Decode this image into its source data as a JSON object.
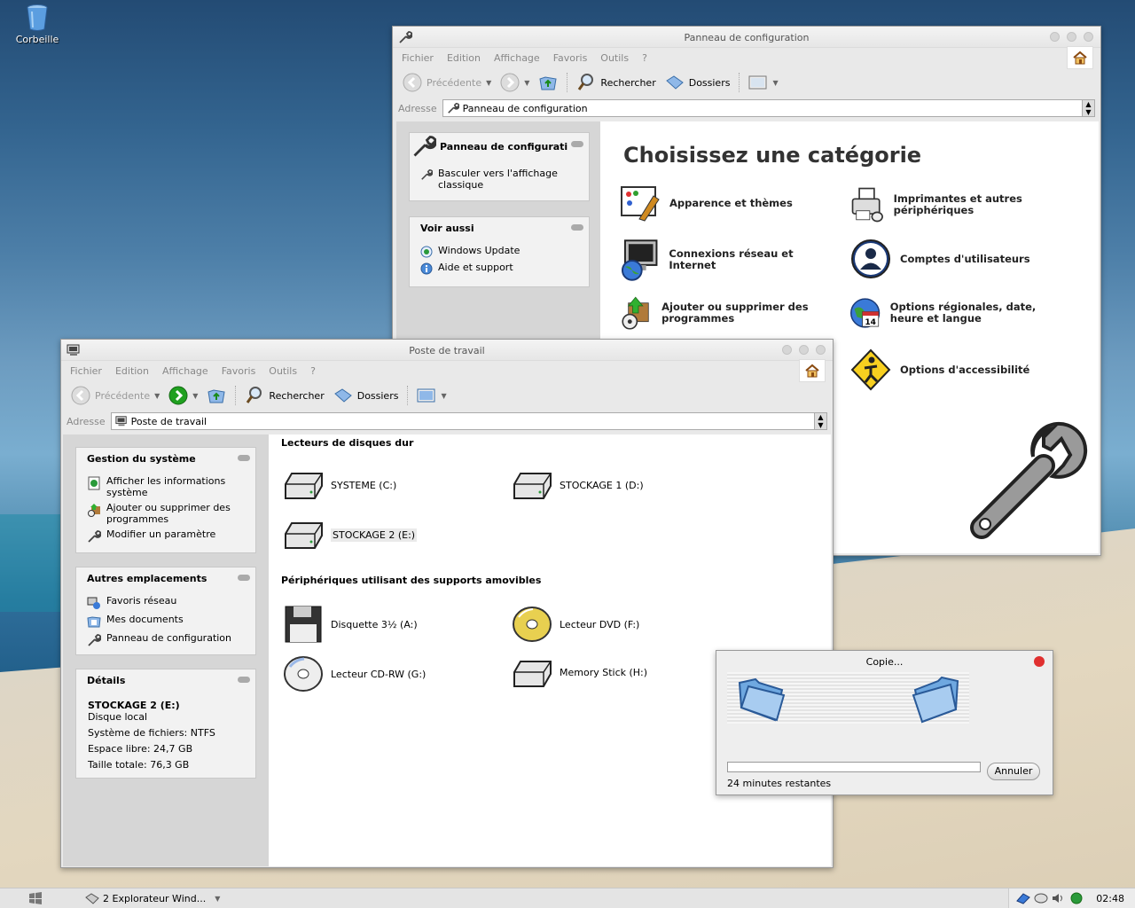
{
  "desktop": {
    "recycle_label": "Corbeille"
  },
  "control_panel": {
    "title": "Panneau de configuration",
    "menu": [
      "Fichier",
      "Edition",
      "Affichage",
      "Favoris",
      "Outils",
      "?"
    ],
    "toolbar": {
      "back": "Précédente",
      "search": "Rechercher",
      "folders": "Dossiers"
    },
    "address_label": "Adresse",
    "address_value": "Panneau de configuration",
    "panel1": {
      "title": "Panneau de configurati",
      "link": "Basculer vers l'affichage classique"
    },
    "panel2": {
      "title": "Voir aussi",
      "links": [
        "Windows Update",
        "Aide et support"
      ]
    },
    "heading": "Choisissez une catégorie",
    "categories": [
      {
        "label": "Apparence et thèmes",
        "icon": "appearance-icon"
      },
      {
        "label": "Imprimantes et autres périphériques",
        "icon": "printer-icon"
      },
      {
        "label": "Connexions réseau et Internet",
        "icon": "network-icon"
      },
      {
        "label": "Comptes d'utilisateurs",
        "icon": "user-accounts-icon"
      },
      {
        "label": "Ajouter ou supprimer des programmes",
        "icon": "add-remove-icon"
      },
      {
        "label": "Options régionales, date, heure et langue",
        "icon": "regional-icon"
      },
      {
        "label": "Options d'accessibilité",
        "icon": "accessibility-icon"
      }
    ]
  },
  "my_computer": {
    "title": "Poste de travail",
    "menu": [
      "Fichier",
      "Edition",
      "Affichage",
      "Favoris",
      "Outils",
      "?"
    ],
    "toolbar": {
      "back": "Précédente",
      "search": "Rechercher",
      "folders": "Dossiers"
    },
    "address_label": "Adresse",
    "address_value": "Poste de travail",
    "tasks": {
      "title": "Gestion du système",
      "links": [
        "Afficher les informations système",
        "Ajouter ou supprimer des programmes",
        "Modifier un paramètre"
      ]
    },
    "places": {
      "title": "Autres emplacements",
      "links": [
        "Favoris réseau",
        "Mes documents",
        "Panneau de configuration"
      ]
    },
    "details": {
      "title": "Détails",
      "name": "STOCKAGE 2 (E:)",
      "type": "Disque local",
      "fs": "Système de fichiers: NTFS",
      "free": "Espace libre: 24,7 GB",
      "total": "Taille totale: 76,3 GB"
    },
    "section_hdd": "Lecteurs de disques dur",
    "hdd": [
      "SYSTEME (C:)",
      "STOCKAGE 1 (D:)",
      "STOCKAGE 2 (E:)"
    ],
    "section_removable": "Périphériques utilisant des supports amovibles",
    "removable": [
      {
        "label": "Disquette 3½ (A:)",
        "icon": "floppy-icon"
      },
      {
        "label": "Lecteur DVD (F:)",
        "icon": "dvd-icon"
      },
      {
        "label": "Lecteur CD-RW (G:)",
        "icon": "cd-icon"
      },
      {
        "label": "Memory Stick (H:)",
        "icon": "memory-stick-icon"
      }
    ]
  },
  "copy_dialog": {
    "title": "Copie...",
    "cancel": "Annuler",
    "remaining": "24 minutes restantes",
    "progress": 0
  },
  "taskbar": {
    "task_label": "2 Explorateur Wind...",
    "clock": "02:48"
  }
}
